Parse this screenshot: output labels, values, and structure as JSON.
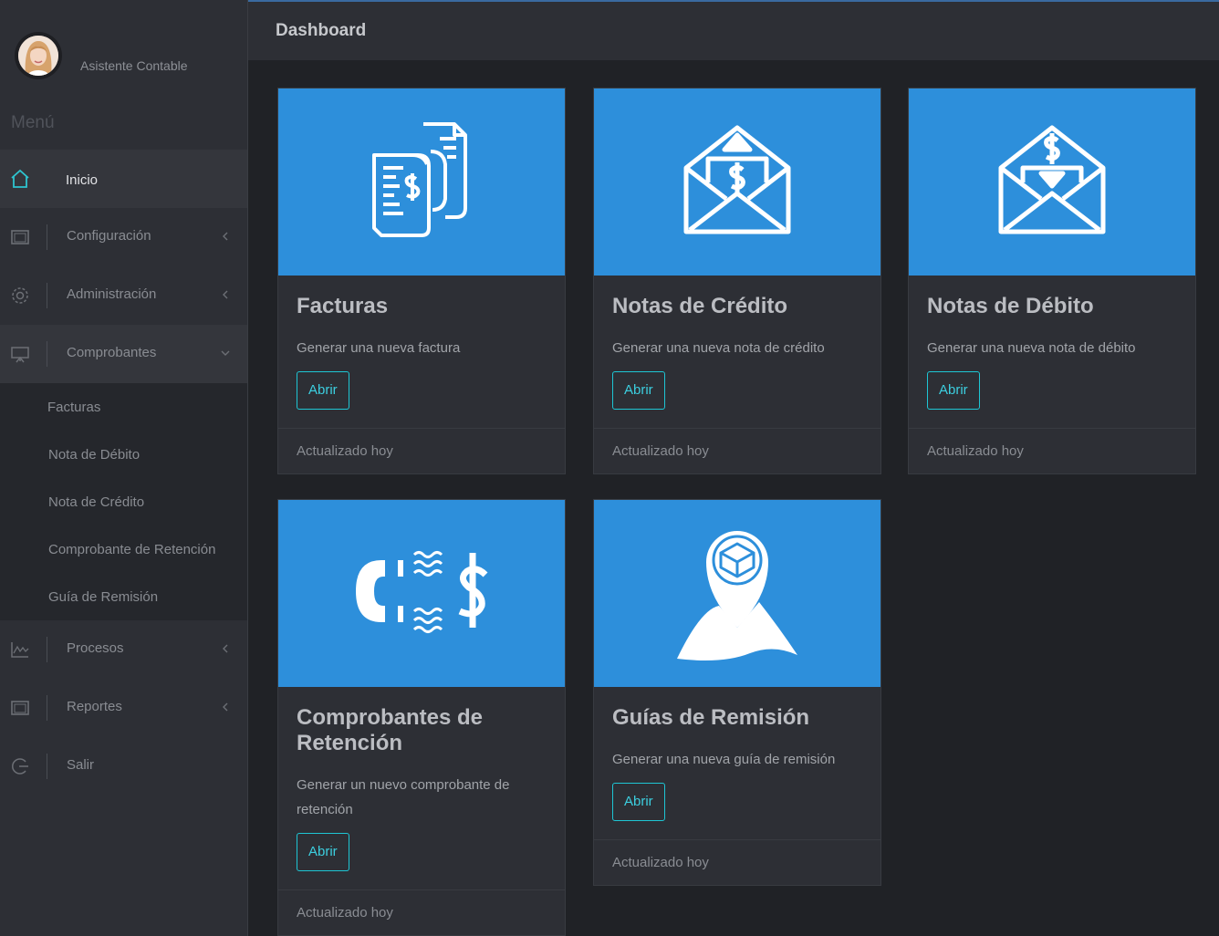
{
  "profile": {
    "name": "Asistente Contable"
  },
  "sidebar": {
    "menu_title": "Menú",
    "items": [
      {
        "label": "Inicio",
        "icon": "home-icon"
      },
      {
        "label": "Configuración",
        "icon": "window-icon"
      },
      {
        "label": "Administración",
        "icon": "gear-icon"
      },
      {
        "label": "Comprobantes",
        "icon": "presentation-icon"
      }
    ],
    "submenu": [
      {
        "label": "Facturas"
      },
      {
        "label": "Nota de Débito"
      },
      {
        "label": "Nota de Crédito"
      },
      {
        "label": "Comprobante de Retención"
      },
      {
        "label": "Guía de Remisión"
      }
    ],
    "items_after": [
      {
        "label": "Procesos",
        "icon": "chart-icon"
      },
      {
        "label": "Reportes",
        "icon": "window-icon"
      },
      {
        "label": "Salir",
        "icon": "logout-icon"
      }
    ]
  },
  "header": {
    "title": "Dashboard"
  },
  "cards": [
    {
      "title": "Facturas",
      "desc": "Generar una nueva factura",
      "button": "Abrir",
      "footer": "Actualizado hoy",
      "icon": "invoice-icon"
    },
    {
      "title": "Notas de Crédito",
      "desc": "Generar una nueva nota de crédito",
      "button": "Abrir",
      "footer": "Actualizado hoy",
      "icon": "envelope-up-icon"
    },
    {
      "title": "Notas de Débito",
      "desc": "Generar una nueva nota de débito",
      "button": "Abrir",
      "footer": "Actualizado hoy",
      "icon": "envelope-down-icon"
    },
    {
      "title": "Comprobantes de Retención",
      "desc": "Generar un nuevo comprobante de retención",
      "button": "Abrir",
      "footer": "Actualizado hoy",
      "icon": "magnet-dollar-icon"
    },
    {
      "title": "Guías de Remisión",
      "desc": "Generar una nueva guía de remisión",
      "button": "Abrir",
      "footer": "Actualizado hoy",
      "icon": "map-pin-box-icon"
    }
  ],
  "colors": {
    "accent": "#2d8fdb",
    "button_border": "#1ec6d4",
    "active_icon": "#2ec4cf"
  }
}
